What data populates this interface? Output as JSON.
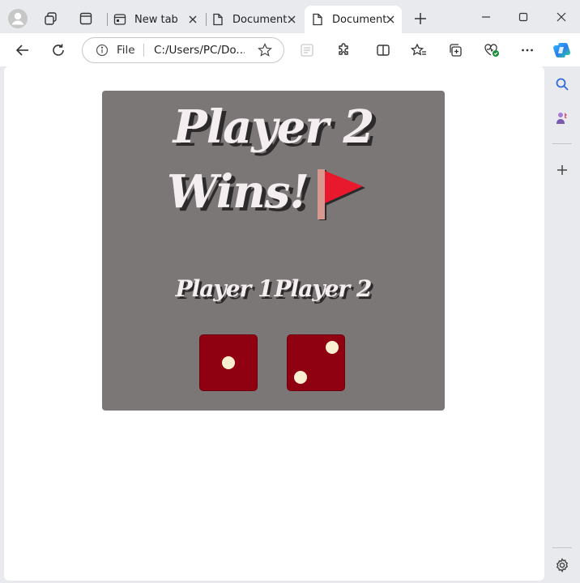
{
  "browser": {
    "tabs": [
      {
        "label": "New tab",
        "active": false
      },
      {
        "label": "Document",
        "active": false
      },
      {
        "label": "Document",
        "active": true
      }
    ],
    "address": {
      "scheme_label": "File",
      "url": "C:/Users/PC/Do..."
    }
  },
  "game": {
    "result_line1": "Player 2",
    "result_line2": "Wins!",
    "player1_label": "Player 1",
    "player2_label": "Player 2",
    "dice": [
      1,
      2
    ]
  },
  "colors": {
    "card_bg": "#7b7777",
    "die_red": "#8f0010",
    "pip": "#fbefd2",
    "flag_red": "#e8192c"
  }
}
